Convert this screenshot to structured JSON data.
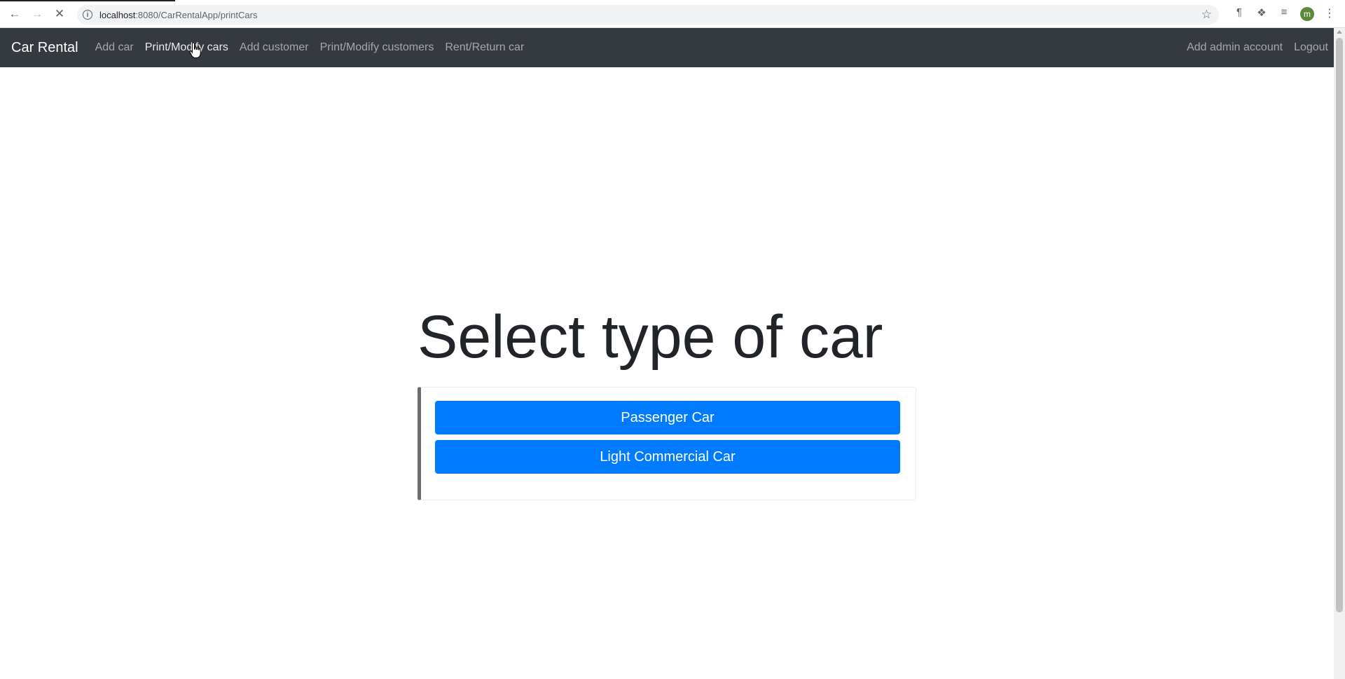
{
  "browser": {
    "url_host": "localhost",
    "url_rest": ":8080/CarRentalApp/printCars",
    "avatar_letter": "m"
  },
  "navbar": {
    "brand": "Car Rental",
    "links": [
      {
        "label": "Add car"
      },
      {
        "label": "Print/Modify cars"
      },
      {
        "label": "Add customer"
      },
      {
        "label": "Print/Modify customers"
      },
      {
        "label": "Rent/Return car"
      }
    ],
    "right_links": [
      {
        "label": "Add admin account"
      },
      {
        "label": "Logout"
      }
    ]
  },
  "main": {
    "heading": "Select type of car",
    "buttons": [
      {
        "label": "Passenger Car"
      },
      {
        "label": "Light Commercial Car"
      }
    ]
  },
  "colors": {
    "navbar_bg": "#343a40",
    "primary": "#007bff"
  }
}
